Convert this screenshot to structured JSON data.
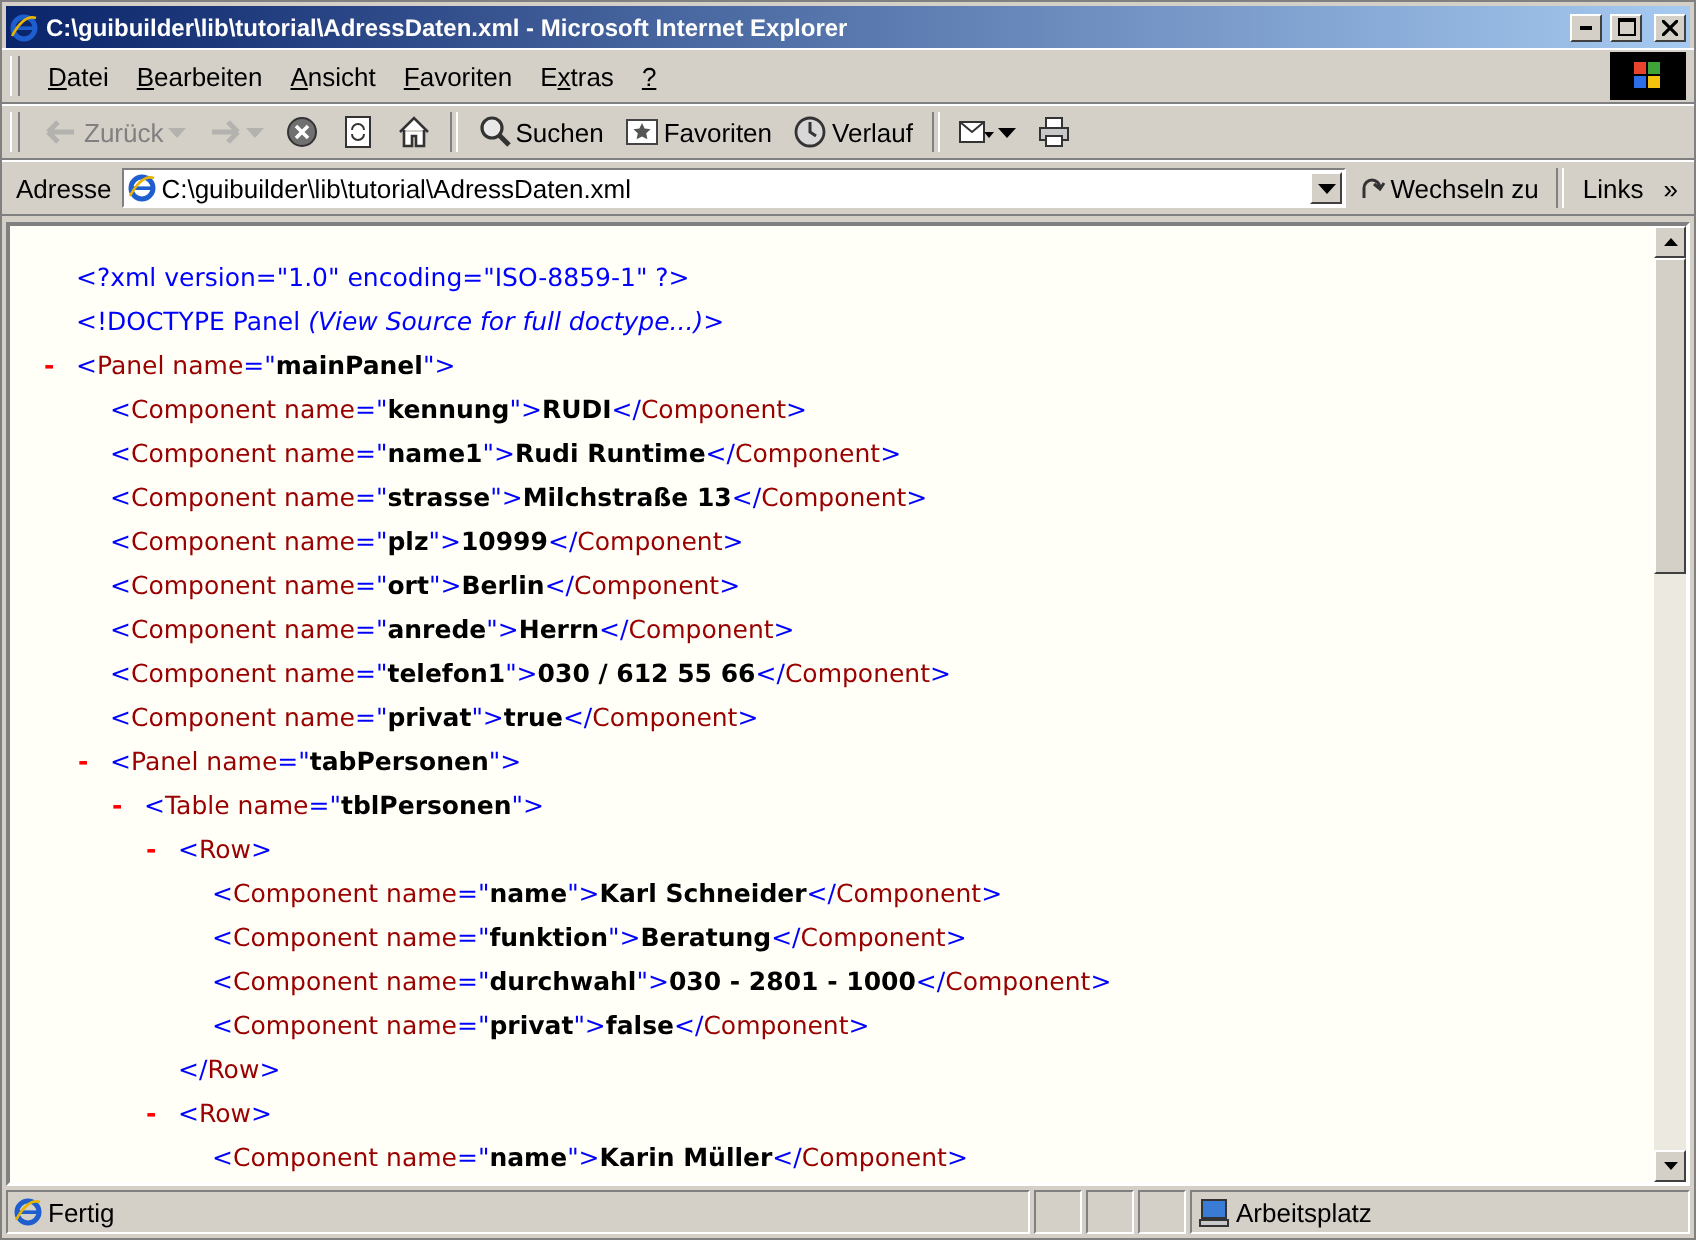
{
  "window": {
    "title": "C:\\guibuilder\\lib\\tutorial\\AdressDaten.xml - Microsoft Internet Explorer"
  },
  "menu": [
    {
      "key": "D",
      "after": "atei"
    },
    {
      "key": "B",
      "after": "earbeiten"
    },
    {
      "key": "A",
      "after": "nsicht"
    },
    {
      "key": "F",
      "after": "avoriten"
    },
    {
      "before": "E",
      "key": "x",
      "after": "tras"
    },
    {
      "key": "?"
    }
  ],
  "toolbar": [
    {
      "kind": "back",
      "label": "Zurück",
      "disabled": true,
      "dropdown": true
    },
    {
      "kind": "forward",
      "disabled": true,
      "dropdown": true
    },
    {
      "kind": "stop",
      "disabled": false
    },
    {
      "kind": "refresh",
      "disabled": false
    },
    {
      "kind": "home",
      "disabled": false
    },
    {
      "kind": "search",
      "label": "Suchen",
      "disabled": false
    },
    {
      "kind": "favorites",
      "label": "Favoriten",
      "disabled": false
    },
    {
      "kind": "history",
      "label": "Verlauf",
      "disabled": false
    },
    {
      "kind": "mail",
      "disabled": false,
      "dropdown": true
    },
    {
      "kind": "print",
      "disabled": false
    }
  ],
  "address_bar": {
    "label": "Adresse",
    "value": "C:\\guibuilder\\lib\\tutorial\\AdressDaten.xml",
    "go_button": "Wechseln zu",
    "links": "Links",
    "more": "»"
  },
  "document": {
    "declarations": [
      {
        "segments": [
          {
            "kind": "markup",
            "text": "<?xml version=\"1.0\" encoding=\"ISO-8859-1\" ?>"
          }
        ]
      },
      {
        "segments": [
          {
            "kind": "markup",
            "text": "<!DOCTYPE Panel "
          },
          {
            "kind": "note",
            "text": "(View Source for full doctype...)"
          },
          {
            "kind": "markup",
            "text": ">"
          }
        ]
      }
    ],
    "root": {
      "toggle": "-",
      "segments": [
        {
          "kind": "markup",
          "text": "<"
        },
        {
          "kind": "name",
          "text": "Panel name"
        },
        {
          "kind": "markup",
          "text": "=\""
        },
        {
          "kind": "value",
          "text": "mainPanel"
        },
        {
          "kind": "markup",
          "text": "\">"
        }
      ],
      "children": [
        {
          "segments": [
            {
              "kind": "markup",
              "text": "<"
            },
            {
              "kind": "name",
              "text": "Component name"
            },
            {
              "kind": "markup",
              "text": "=\""
            },
            {
              "kind": "value",
              "text": "kennung"
            },
            {
              "kind": "markup",
              "text": "\">"
            },
            {
              "kind": "content",
              "text": "RUDI"
            },
            {
              "kind": "markup",
              "text": "</"
            },
            {
              "kind": "name",
              "text": "Component"
            },
            {
              "kind": "markup",
              "text": ">"
            }
          ]
        },
        {
          "segments": [
            {
              "kind": "markup",
              "text": "<"
            },
            {
              "kind": "name",
              "text": "Component name"
            },
            {
              "kind": "markup",
              "text": "=\""
            },
            {
              "kind": "value",
              "text": "name1"
            },
            {
              "kind": "markup",
              "text": "\">"
            },
            {
              "kind": "content",
              "text": "Rudi Runtime"
            },
            {
              "kind": "markup",
              "text": "</"
            },
            {
              "kind": "name",
              "text": "Component"
            },
            {
              "kind": "markup",
              "text": ">"
            }
          ]
        },
        {
          "segments": [
            {
              "kind": "markup",
              "text": "<"
            },
            {
              "kind": "name",
              "text": "Component name"
            },
            {
              "kind": "markup",
              "text": "=\""
            },
            {
              "kind": "value",
              "text": "strasse"
            },
            {
              "kind": "markup",
              "text": "\">"
            },
            {
              "kind": "content",
              "text": "Milchstraße 13"
            },
            {
              "kind": "markup",
              "text": "</"
            },
            {
              "kind": "name",
              "text": "Component"
            },
            {
              "kind": "markup",
              "text": ">"
            }
          ]
        },
        {
          "segments": [
            {
              "kind": "markup",
              "text": "<"
            },
            {
              "kind": "name",
              "text": "Component name"
            },
            {
              "kind": "markup",
              "text": "=\""
            },
            {
              "kind": "value",
              "text": "plz"
            },
            {
              "kind": "markup",
              "text": "\">"
            },
            {
              "kind": "content",
              "text": "10999"
            },
            {
              "kind": "markup",
              "text": "</"
            },
            {
              "kind": "name",
              "text": "Component"
            },
            {
              "kind": "markup",
              "text": ">"
            }
          ]
        },
        {
          "segments": [
            {
              "kind": "markup",
              "text": "<"
            },
            {
              "kind": "name",
              "text": "Component name"
            },
            {
              "kind": "markup",
              "text": "=\""
            },
            {
              "kind": "value",
              "text": "ort"
            },
            {
              "kind": "markup",
              "text": "\">"
            },
            {
              "kind": "content",
              "text": "Berlin"
            },
            {
              "kind": "markup",
              "text": "</"
            },
            {
              "kind": "name",
              "text": "Component"
            },
            {
              "kind": "markup",
              "text": ">"
            }
          ]
        },
        {
          "segments": [
            {
              "kind": "markup",
              "text": "<"
            },
            {
              "kind": "name",
              "text": "Component name"
            },
            {
              "kind": "markup",
              "text": "=\""
            },
            {
              "kind": "value",
              "text": "anrede"
            },
            {
              "kind": "markup",
              "text": "\">"
            },
            {
              "kind": "content",
              "text": "Herrn"
            },
            {
              "kind": "markup",
              "text": "</"
            },
            {
              "kind": "name",
              "text": "Component"
            },
            {
              "kind": "markup",
              "text": ">"
            }
          ]
        },
        {
          "segments": [
            {
              "kind": "markup",
              "text": "<"
            },
            {
              "kind": "name",
              "text": "Component name"
            },
            {
              "kind": "markup",
              "text": "=\""
            },
            {
              "kind": "value",
              "text": "telefon1"
            },
            {
              "kind": "markup",
              "text": "\">"
            },
            {
              "kind": "content",
              "text": "030 / 612 55 66"
            },
            {
              "kind": "markup",
              "text": "</"
            },
            {
              "kind": "name",
              "text": "Component"
            },
            {
              "kind": "markup",
              "text": ">"
            }
          ]
        },
        {
          "segments": [
            {
              "kind": "markup",
              "text": "<"
            },
            {
              "kind": "name",
              "text": "Component name"
            },
            {
              "kind": "markup",
              "text": "=\""
            },
            {
              "kind": "value",
              "text": "privat"
            },
            {
              "kind": "markup",
              "text": "\">"
            },
            {
              "kind": "content",
              "text": "true"
            },
            {
              "kind": "markup",
              "text": "</"
            },
            {
              "kind": "name",
              "text": "Component"
            },
            {
              "kind": "markup",
              "text": ">"
            }
          ]
        },
        {
          "toggle": "-",
          "segments": [
            {
              "kind": "markup",
              "text": "<"
            },
            {
              "kind": "name",
              "text": "Panel name"
            },
            {
              "kind": "markup",
              "text": "=\""
            },
            {
              "kind": "value",
              "text": "tabPersonen"
            },
            {
              "kind": "markup",
              "text": "\">"
            }
          ],
          "children": [
            {
              "toggle": "-",
              "segments": [
                {
                  "kind": "markup",
                  "text": "<"
                },
                {
                  "kind": "name",
                  "text": "Table name"
                },
                {
                  "kind": "markup",
                  "text": "=\""
                },
                {
                  "kind": "value",
                  "text": "tblPersonen"
                },
                {
                  "kind": "markup",
                  "text": "\">"
                }
              ],
              "children": [
                {
                  "toggle": "-",
                  "segments": [
                    {
                      "kind": "markup",
                      "text": "<"
                    },
                    {
                      "kind": "name",
                      "text": "Row"
                    },
                    {
                      "kind": "markup",
                      "text": ">"
                    }
                  ],
                  "children": [
                    {
                      "segments": [
                        {
                          "kind": "markup",
                          "text": "<"
                        },
                        {
                          "kind": "name",
                          "text": "Component name"
                        },
                        {
                          "kind": "markup",
                          "text": "=\""
                        },
                        {
                          "kind": "value",
                          "text": "name"
                        },
                        {
                          "kind": "markup",
                          "text": "\">"
                        },
                        {
                          "kind": "content",
                          "text": "Karl Schneider"
                        },
                        {
                          "kind": "markup",
                          "text": "</"
                        },
                        {
                          "kind": "name",
                          "text": "Component"
                        },
                        {
                          "kind": "markup",
                          "text": ">"
                        }
                      ]
                    },
                    {
                      "segments": [
                        {
                          "kind": "markup",
                          "text": "<"
                        },
                        {
                          "kind": "name",
                          "text": "Component name"
                        },
                        {
                          "kind": "markup",
                          "text": "=\""
                        },
                        {
                          "kind": "value",
                          "text": "funktion"
                        },
                        {
                          "kind": "markup",
                          "text": "\">"
                        },
                        {
                          "kind": "content",
                          "text": "Beratung"
                        },
                        {
                          "kind": "markup",
                          "text": "</"
                        },
                        {
                          "kind": "name",
                          "text": "Component"
                        },
                        {
                          "kind": "markup",
                          "text": ">"
                        }
                      ]
                    },
                    {
                      "segments": [
                        {
                          "kind": "markup",
                          "text": "<"
                        },
                        {
                          "kind": "name",
                          "text": "Component name"
                        },
                        {
                          "kind": "markup",
                          "text": "=\""
                        },
                        {
                          "kind": "value",
                          "text": "durchwahl"
                        },
                        {
                          "kind": "markup",
                          "text": "\">"
                        },
                        {
                          "kind": "content",
                          "text": "030 - 2801 - 1000"
                        },
                        {
                          "kind": "markup",
                          "text": "</"
                        },
                        {
                          "kind": "name",
                          "text": "Component"
                        },
                        {
                          "kind": "markup",
                          "text": ">"
                        }
                      ]
                    },
                    {
                      "segments": [
                        {
                          "kind": "markup",
                          "text": "<"
                        },
                        {
                          "kind": "name",
                          "text": "Component name"
                        },
                        {
                          "kind": "markup",
                          "text": "=\""
                        },
                        {
                          "kind": "value",
                          "text": "privat"
                        },
                        {
                          "kind": "markup",
                          "text": "\">"
                        },
                        {
                          "kind": "content",
                          "text": "false"
                        },
                        {
                          "kind": "markup",
                          "text": "</"
                        },
                        {
                          "kind": "name",
                          "text": "Component"
                        },
                        {
                          "kind": "markup",
                          "text": ">"
                        }
                      ]
                    }
                  ],
                  "closing": [
                    {
                      "kind": "markup",
                      "text": "</"
                    },
                    {
                      "kind": "name",
                      "text": "Row"
                    },
                    {
                      "kind": "markup",
                      "text": ">"
                    }
                  ]
                },
                {
                  "toggle": "-",
                  "segments": [
                    {
                      "kind": "markup",
                      "text": "<"
                    },
                    {
                      "kind": "name",
                      "text": "Row"
                    },
                    {
                      "kind": "markup",
                      "text": ">"
                    }
                  ],
                  "children": [
                    {
                      "segments": [
                        {
                          "kind": "markup",
                          "text": "<"
                        },
                        {
                          "kind": "name",
                          "text": "Component name"
                        },
                        {
                          "kind": "markup",
                          "text": "=\""
                        },
                        {
                          "kind": "value",
                          "text": "name"
                        },
                        {
                          "kind": "markup",
                          "text": "\">"
                        },
                        {
                          "kind": "content",
                          "text": "Karin Müller"
                        },
                        {
                          "kind": "markup",
                          "text": "</"
                        },
                        {
                          "kind": "name",
                          "text": "Component"
                        },
                        {
                          "kind": "markup",
                          "text": ">"
                        }
                      ]
                    }
                  ]
                }
              ]
            }
          ]
        }
      ]
    }
  },
  "status_bar": {
    "text": "Fertig",
    "zone": "Arbeitsplatz"
  }
}
